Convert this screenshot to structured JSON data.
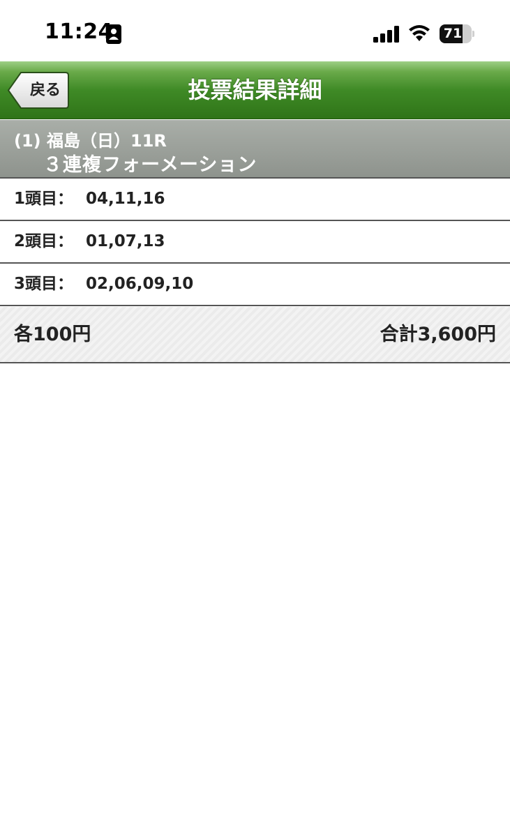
{
  "status_bar": {
    "time": "11:24",
    "battery": "71",
    "battery_level": 0.71
  },
  "nav": {
    "back_label": "戻る",
    "title": "投票結果詳細"
  },
  "race": {
    "line1": "(1) 福島（日）11R",
    "line2": "３連複フォーメーション"
  },
  "rows": [
    {
      "label": "1頭目：",
      "value": "04,11,16"
    },
    {
      "label": "2頭目：",
      "value": "01,07,13"
    },
    {
      "label": "3頭目：",
      "value": "02,06,09,10"
    }
  ],
  "summary": {
    "each": "各100円",
    "total": "合計3,600円"
  },
  "colors": {
    "nav_green": "#3f8a26",
    "header_gray": "#8e938d"
  }
}
